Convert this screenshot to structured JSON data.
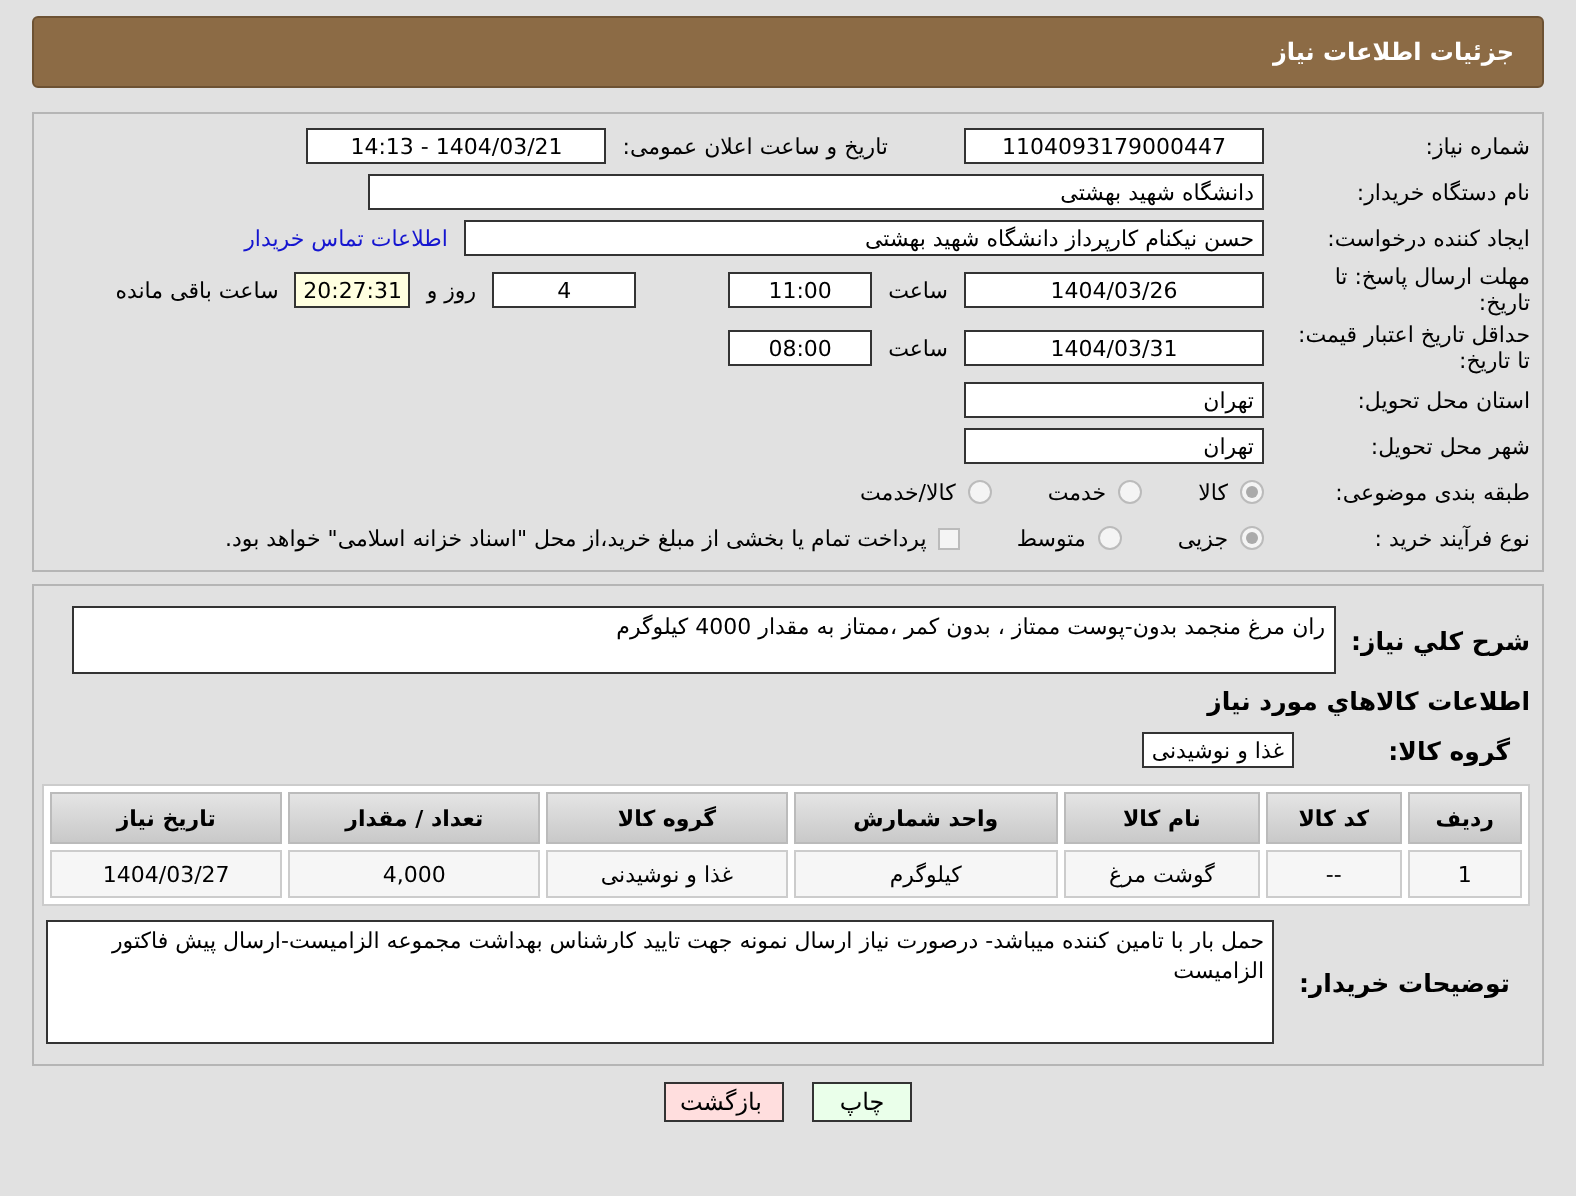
{
  "header": {
    "title": "جزئیات اطلاعات نیاز"
  },
  "need_number": {
    "label": "شماره نیاز:",
    "value": "1104093179000447"
  },
  "announce": {
    "label": "تاریخ و ساعت اعلان عمومی:",
    "value": "1404/03/21 - 14:13"
  },
  "buyer_org": {
    "label": "نام دستگاه خریدار:",
    "value": "دانشگاه شهید بهشتی"
  },
  "requester": {
    "label": "ایجاد کننده درخواست:",
    "value": "حسن نیکنام کارپرداز دانشگاه شهید بهشتی",
    "link": "اطلاعات تماس خریدار"
  },
  "response_deadline": {
    "label": "مهلت ارسال پاسخ: تا تاریخ:",
    "date": "1404/03/26",
    "time_label": "ساعت",
    "time": "11:00",
    "days": "4",
    "days_label": "روز و",
    "remaining": "20:27:31",
    "remaining_label": "ساعت باقی مانده"
  },
  "price_validity": {
    "label": "حداقل تاریخ اعتبار قیمت: تا تاریخ:",
    "date": "1404/03/31",
    "time_label": "ساعت",
    "time": "08:00"
  },
  "province": {
    "label": "استان محل تحویل:",
    "value": "تهران"
  },
  "city": {
    "label": "شهر محل تحویل:",
    "value": "تهران"
  },
  "category": {
    "label": "طبقه بندی موضوعی:",
    "options": [
      {
        "label": "کالا",
        "selected": true
      },
      {
        "label": "خدمت",
        "selected": false
      },
      {
        "label": "کالا/خدمت",
        "selected": false
      }
    ]
  },
  "process": {
    "label": "نوع فرآیند خرید :",
    "options": [
      {
        "label": "جزیی",
        "selected": true
      },
      {
        "label": "متوسط",
        "selected": false
      }
    ],
    "treasury": {
      "label": "پرداخت تمام یا بخشی از مبلغ خرید،از محل \"اسناد خزانه اسلامی\" خواهد بود.",
      "checked": false
    }
  },
  "description": {
    "label": "شرح کلي نیاز:",
    "value": "ران مرغ  منجمد بدون-پوست ممتاز ، بدون کمر ،ممتاز به مقدار 4000 کیلوگرم"
  },
  "goods_title": "اطلاعات کالاهاي مورد نیاز",
  "goods_group": {
    "label": "گروه کالا:",
    "value": "غذا و نوشیدنی"
  },
  "table": {
    "columns": [
      "ردیف",
      "کد کالا",
      "نام کالا",
      "واحد شمارش",
      "گروه کالا",
      "تعداد / مقدار",
      "تاریخ نیاز"
    ],
    "rows": [
      [
        "1",
        "--",
        "گوشت مرغ",
        "کیلوگرم",
        "غذا و نوشیدنی",
        "4,000",
        "1404/03/27"
      ]
    ]
  },
  "buyer_notes": {
    "label": "توضیحات خریدار:",
    "value": "حمل بار با تامین کننده میباشد- درصورت نیاز ارسال نمونه جهت تایید کارشناس بهداشت مجموعه الزامیست-ارسال پیش فاکتور الزامیست"
  },
  "buttons": [
    {
      "kind": "print",
      "label": "چاپ"
    },
    {
      "kind": "back",
      "label": "بازگشت"
    }
  ]
}
